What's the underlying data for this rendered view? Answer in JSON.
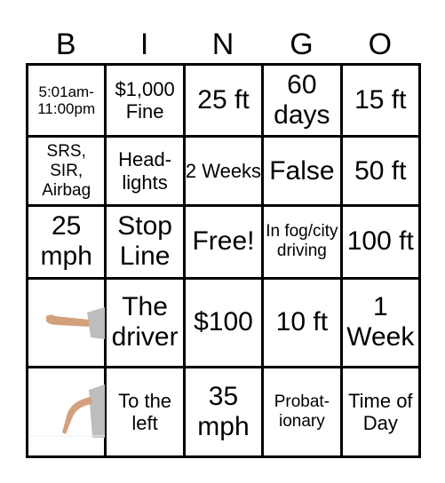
{
  "header": [
    "B",
    "I",
    "N",
    "G",
    "O"
  ],
  "rows": [
    [
      {
        "t": "5:01am-11:00pm",
        "s": "f1"
      },
      {
        "t": "$1,000 Fine",
        "s": "f2"
      },
      {
        "t": "25 ft",
        "s": "f3"
      },
      {
        "t": "60 days",
        "s": "f3"
      },
      {
        "t": "15 ft",
        "s": "f3"
      }
    ],
    [
      {
        "t": "SRS, SIR, Airbag",
        "s": "f4"
      },
      {
        "t": "Head-lights",
        "s": "f2"
      },
      {
        "t": "2 Weeks",
        "s": "f2"
      },
      {
        "t": "False",
        "s": "f3"
      },
      {
        "t": "50 ft",
        "s": "f3"
      }
    ],
    [
      {
        "t": "25 mph",
        "s": "f3"
      },
      {
        "t": "Stop Line",
        "s": "f3"
      },
      {
        "t": "Free!",
        "s": "f3"
      },
      {
        "t": "In fog/city driving",
        "s": "f4"
      },
      {
        "t": "100 ft",
        "s": "f3"
      }
    ],
    [
      {
        "img": "arm-straight-left-signal"
      },
      {
        "t": "The driver",
        "s": "f3"
      },
      {
        "t": "$100",
        "s": "f3"
      },
      {
        "t": "10 ft",
        "s": "f3"
      },
      {
        "t": "1 Week",
        "s": "f3"
      }
    ],
    [
      {
        "img": "arm-down-stop-signal"
      },
      {
        "t": "To the left",
        "s": "f2"
      },
      {
        "t": "35 mph",
        "s": "f3"
      },
      {
        "t": "Probat-ionary",
        "s": "f4"
      },
      {
        "t": "Time of Day",
        "s": "f2"
      }
    ]
  ]
}
